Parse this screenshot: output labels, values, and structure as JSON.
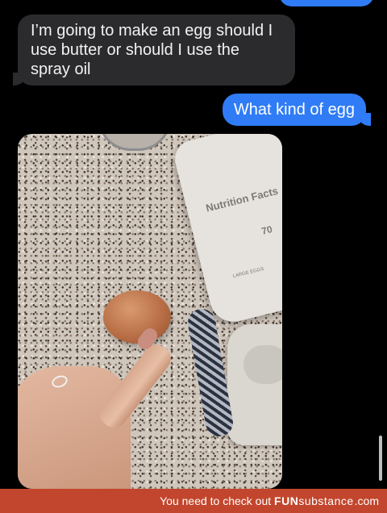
{
  "messages": {
    "incoming": {
      "text": "I’m going to make an egg should I use butter or should I use the spray oil"
    },
    "outgoing": {
      "text": "What kind of egg"
    }
  },
  "photo": {
    "nutrition": {
      "title": "Nutrition Facts",
      "calories": "70",
      "label": "LARGE EGGS"
    }
  },
  "footer": {
    "text": "You need to check out",
    "brand_fun": "FUN",
    "brand_sub": "substance",
    "brand_com": ".com"
  },
  "colors": {
    "incoming_bubble": "#2b2b2d",
    "outgoing_bubble": "#2f7cf6",
    "footer_bar": "#c2462d"
  }
}
